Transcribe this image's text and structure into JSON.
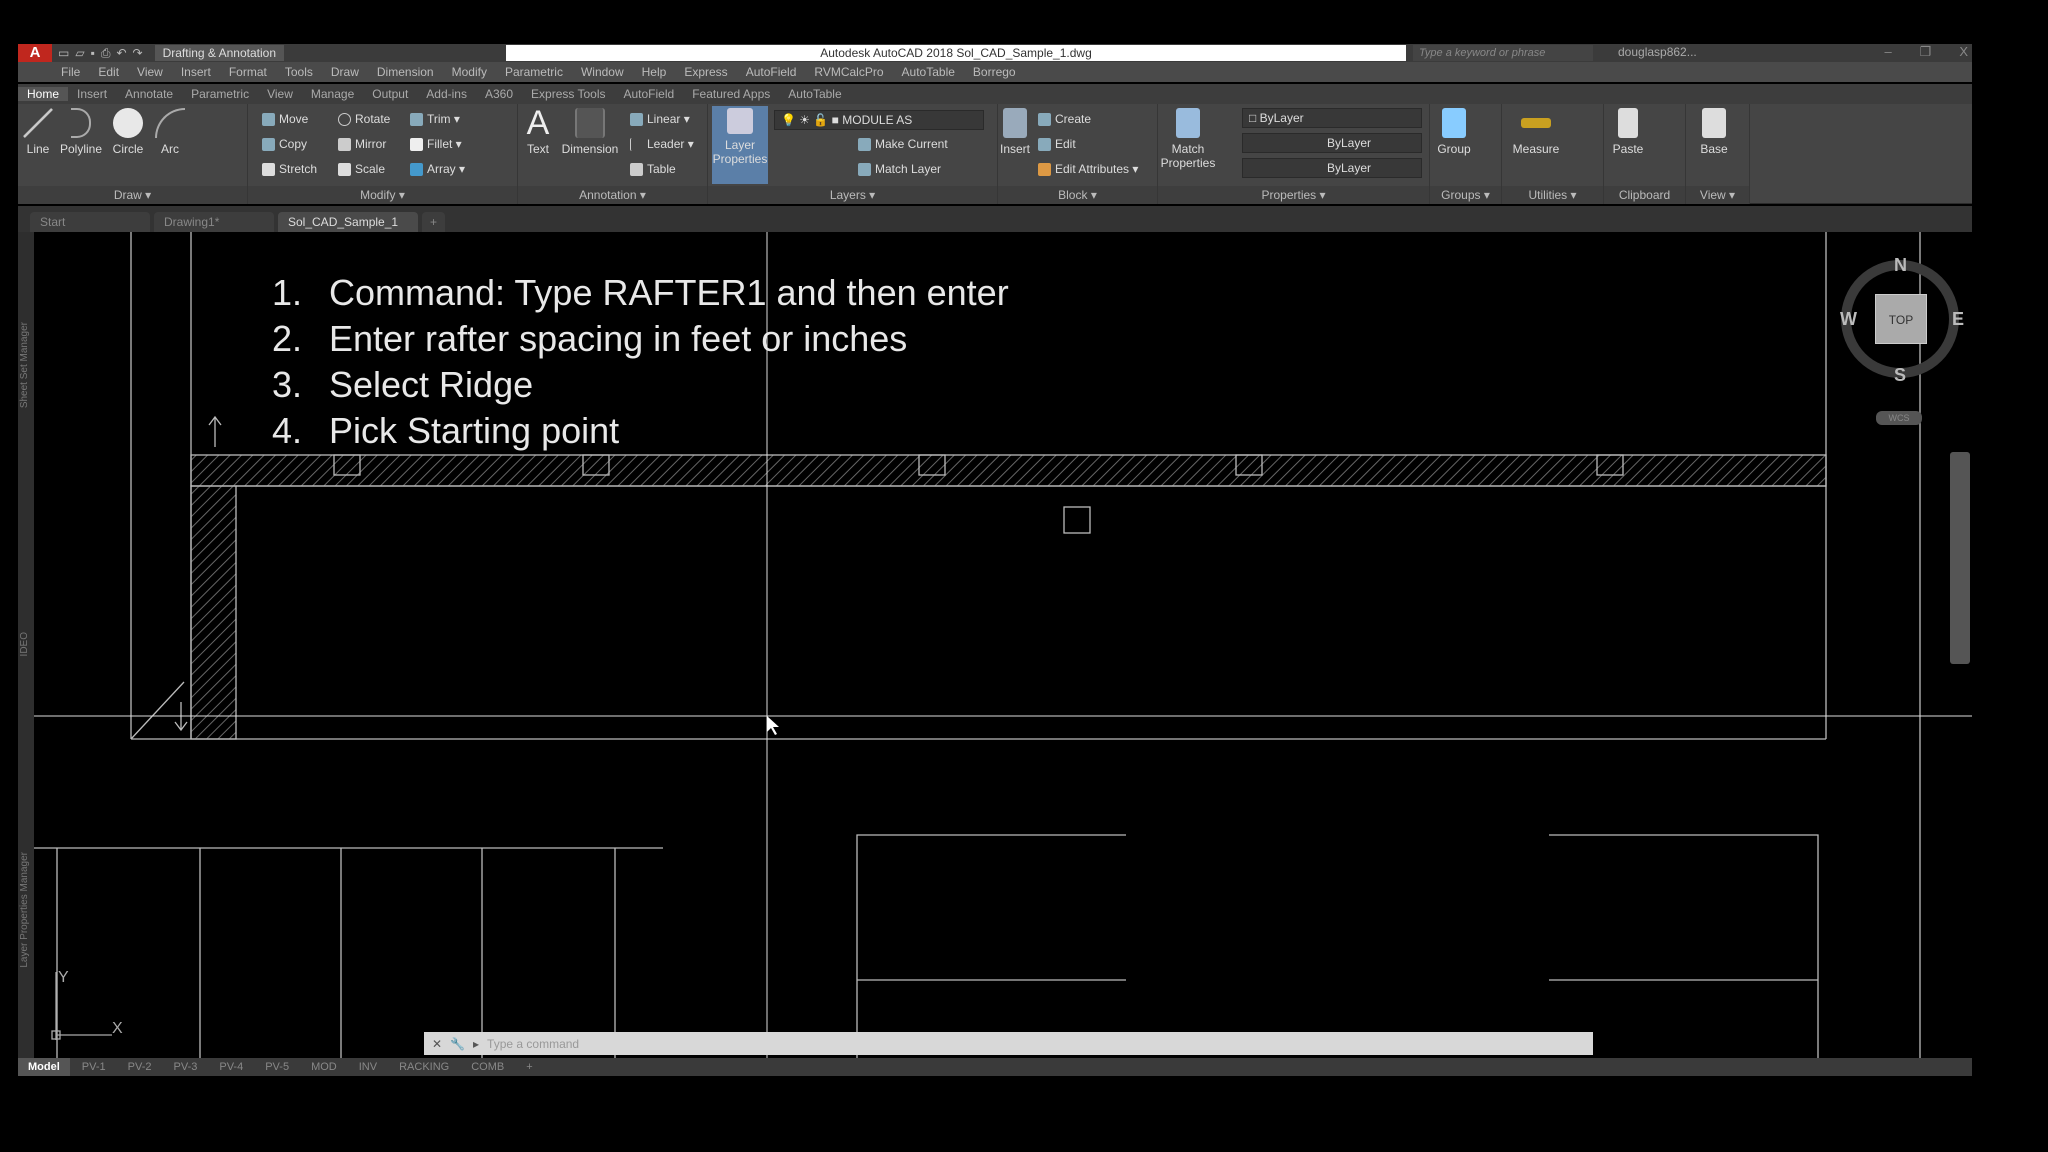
{
  "title_bar": {
    "app_letter": "A",
    "workspace": "Drafting & Annotation",
    "title": "Autodesk AutoCAD 2018   Sol_CAD_Sample_1.dwg",
    "search_placeholder": "Type a keyword or phrase",
    "user": "douglasp862...",
    "min": "–",
    "max": "❐",
    "close": "X"
  },
  "menu": [
    "File",
    "Edit",
    "View",
    "Insert",
    "Format",
    "Tools",
    "Draw",
    "Dimension",
    "Modify",
    "Parametric",
    "Window",
    "Help",
    "Express",
    "AutoField",
    "RVMCalcPro",
    "AutoTable",
    "Borrego"
  ],
  "ribbon_tabs": [
    "Home",
    "Insert",
    "Annotate",
    "Parametric",
    "View",
    "Manage",
    "Output",
    "Add-ins",
    "A360",
    "Express Tools",
    "AutoField",
    "Featured Apps",
    "AutoTable"
  ],
  "ribbon": {
    "draw": {
      "label": "Draw ▾",
      "line": "Line",
      "polyline": "Polyline",
      "circle": "Circle",
      "arc": "Arc"
    },
    "modify": {
      "label": "Modify ▾",
      "move": "Move",
      "rotate": "Rotate",
      "trim": "Trim ▾",
      "copy": "Copy",
      "mirror": "Mirror",
      "fillet": "Fillet ▾",
      "stretch": "Stretch",
      "scale": "Scale",
      "array": "Array ▾"
    },
    "annotation": {
      "label": "Annotation ▾",
      "text": "Text",
      "dimension": "Dimension",
      "linear": "Linear ▾",
      "leader": "Leader ▾",
      "table": "Table"
    },
    "layers": {
      "label": "Layers ▾",
      "layer_properties": "Layer Properties",
      "current_layer": "MODULE AS",
      "make_current": "Make Current",
      "match_layer": "Match Layer"
    },
    "block": {
      "label": "Block ▾",
      "insert": "Insert",
      "create": "Create",
      "edit": "Edit",
      "edit_attributes": "Edit Attributes ▾"
    },
    "properties": {
      "label": "Properties ▾",
      "match_properties": "Match Properties",
      "color": "ByLayer",
      "linetype": "ByLayer",
      "lineweight": "ByLayer"
    },
    "groups": {
      "label": "Groups ▾",
      "group": "Group"
    },
    "utilities": {
      "label": "Utilities ▾",
      "measure": "Measure"
    },
    "clipboard": {
      "label": "Clipboard",
      "paste": "Paste"
    },
    "view": {
      "label": "View ▾",
      "base": "Base"
    }
  },
  "doc_tabs": [
    {
      "label": "Start"
    },
    {
      "label": "Drawing1*"
    },
    {
      "label": "Sol_CAD_Sample_1",
      "active": true
    }
  ],
  "side_palettes": [
    "Sheet Set Manager",
    "IDEO",
    "Layer Properties Manager"
  ],
  "instructions": [
    {
      "n": "1.",
      "text": "Command: Type RAFTER1 and then enter"
    },
    {
      "n": "2.",
      "text": "Enter rafter spacing in feet or inches"
    },
    {
      "n": "3.",
      "text": "Select Ridge"
    },
    {
      "n": "4.",
      "text": "Pick Starting point"
    }
  ],
  "viewcube": {
    "n": "N",
    "s": "S",
    "e": "E",
    "w": "W",
    "face": "TOP",
    "wcs": "WCS"
  },
  "ucs": {
    "x": "X",
    "y": "Y"
  },
  "command_line": {
    "placeholder": "Type a command"
  },
  "layout_tabs": [
    "Model",
    "PV-1",
    "PV-2",
    "PV-3",
    "PV-4",
    "PV-5",
    "MOD",
    "INV",
    "RACKING",
    "COMB",
    "+"
  ]
}
